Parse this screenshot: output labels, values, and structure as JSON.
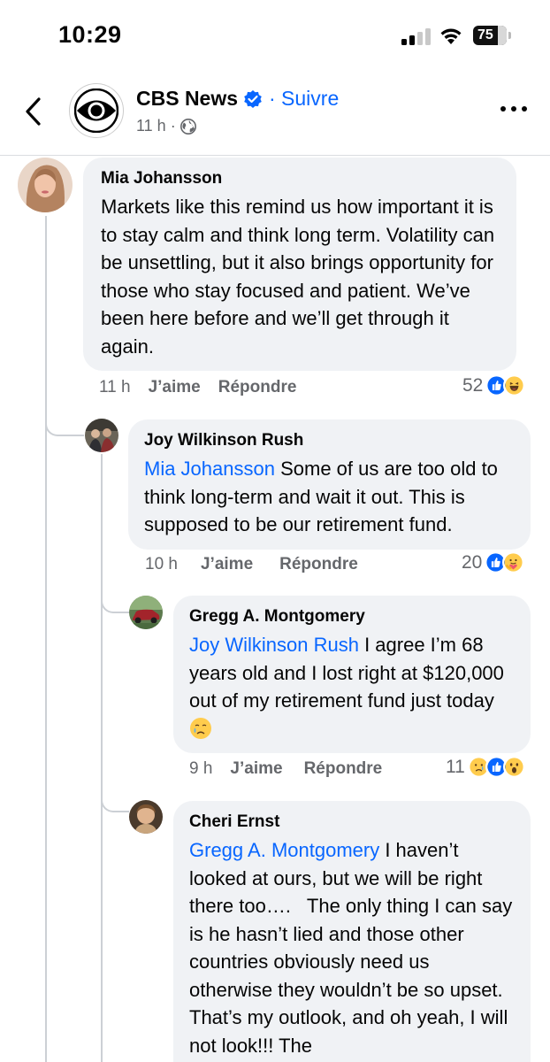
{
  "status_bar": {
    "time": "10:29",
    "battery": "75"
  },
  "header": {
    "page_name": "CBS News",
    "follow_label": "· Suivre",
    "time_ago": "11 h ·"
  },
  "comments": [
    {
      "author": "Mia Johansson",
      "text": "Markets like this remind us how important it is to stay calm and think long term. Volatility can be unsettling, but it also brings opportunity for those who stay focused and patient. We’ve been here before and we’ll get through it again.",
      "time": "11 h",
      "like_label": "J’aime",
      "reply_label": "Répondre",
      "reaction_count": "52",
      "reactions": [
        "like",
        "haha"
      ]
    },
    {
      "author": "Joy Wilkinson Rush",
      "mention": "Mia Johansson",
      "text": " Some of us are too old to think long-term and wait it out. This is supposed to be our retirement fund.",
      "time": "10 h",
      "like_label": "J’aime",
      "reply_label": "Répondre",
      "reaction_count": "20",
      "reactions": [
        "like",
        "care"
      ]
    },
    {
      "author": "Gregg A. Montgomery",
      "mention": "Joy Wilkinson Rush",
      "text": " I agree I’m 68 years old and I lost right at $120,000 out of my retirement fund just today",
      "emoji": "crying-face",
      "time": "9 h",
      "like_label": "J’aime",
      "reply_label": "Répondre",
      "reaction_count": "11",
      "reactions": [
        "sad",
        "like",
        "wow"
      ]
    },
    {
      "author": "Cheri Ernst",
      "mention": "Gregg A. Montgomery",
      "text": " I haven’t looked at ours, but we will be right there too….   The only thing I can say is he hasn’t lied and those other countries obviously need us otherwise they wouldn’t be so upset. That’s my outlook, and oh yeah, I will not look!!! The"
    }
  ],
  "colors": {
    "link": "#0866ff",
    "bubble": "#f0f2f5",
    "meta": "#65676b",
    "like": "#0866ff"
  }
}
